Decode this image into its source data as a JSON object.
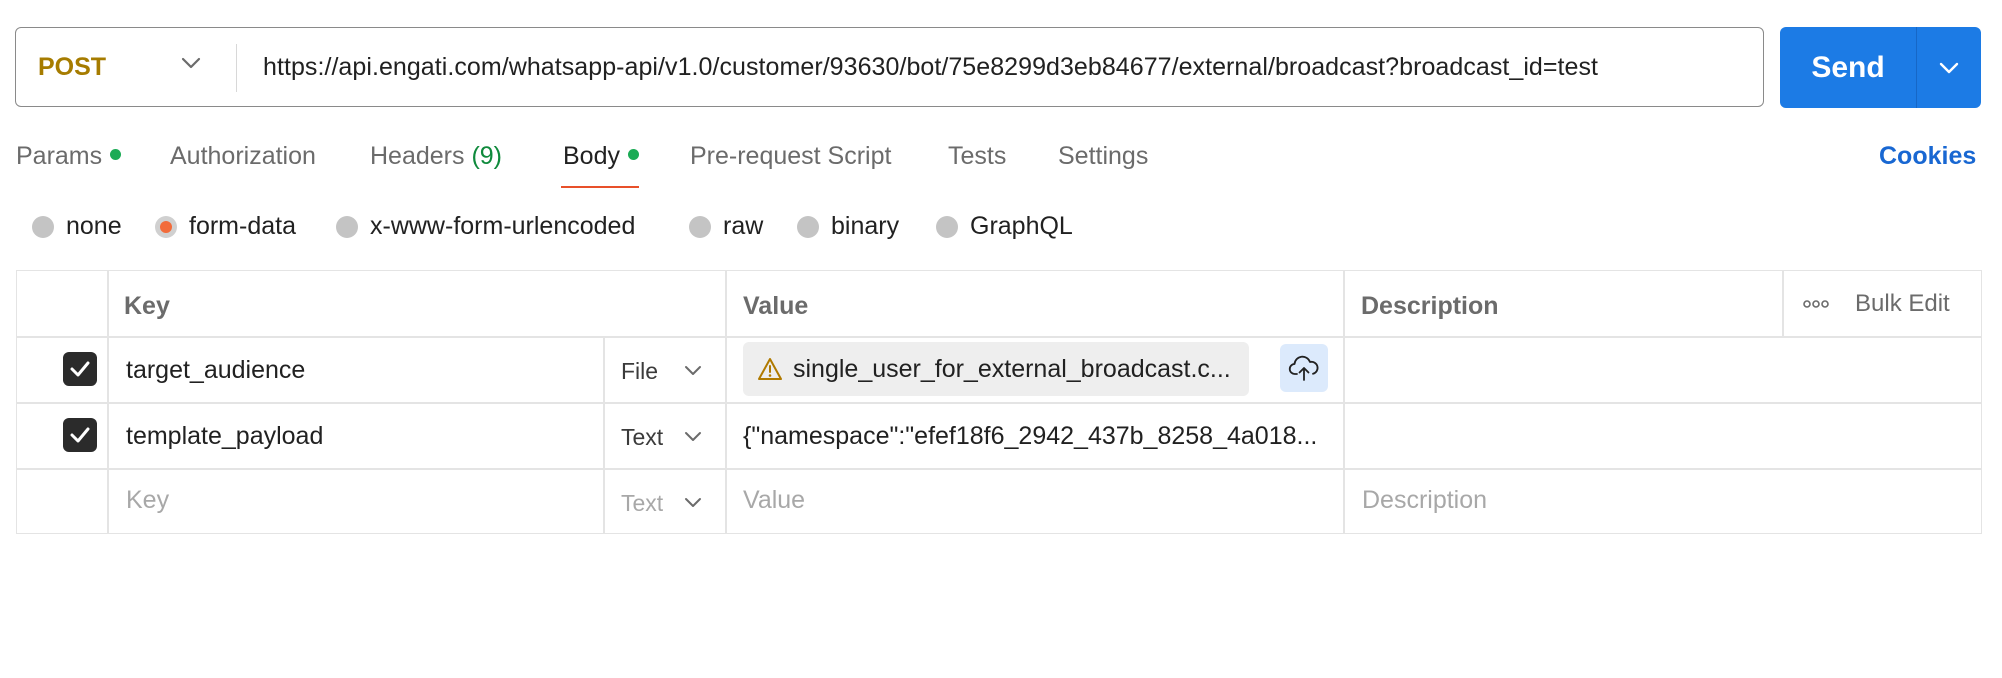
{
  "request": {
    "method": "POST",
    "url": "https://api.engati.com/whatsapp-api/v1.0/customer/93630/bot/75e8299d3eb84677/external/broadcast?broadcast_id=test",
    "send_label": "Send"
  },
  "tabs": {
    "params": "Params",
    "authorization": "Authorization",
    "headers": "Headers",
    "headers_count": "(9)",
    "body": "Body",
    "prerequest": "Pre-request Script",
    "tests": "Tests",
    "settings": "Settings",
    "cookies": "Cookies",
    "active": "Body"
  },
  "body_types": {
    "options": [
      "none",
      "form-data",
      "x-www-form-urlencoded",
      "raw",
      "binary",
      "GraphQL"
    ],
    "selected": "form-data"
  },
  "table": {
    "headers": {
      "key": "Key",
      "value": "Value",
      "description": "Description",
      "bulk_edit": "Bulk Edit"
    },
    "rows": [
      {
        "checked": true,
        "key": "target_audience",
        "type": "File",
        "value": "single_user_for_external_broadcast.c...",
        "description": ""
      },
      {
        "checked": true,
        "key": "template_payload",
        "type": "Text",
        "value": "{\"namespace\":\"efef18f6_2942_437b_8258_4a018...",
        "description": ""
      }
    ],
    "new_row": {
      "key_placeholder": "Key",
      "type": "Text",
      "value_placeholder": "Value",
      "description_placeholder": "Description"
    }
  },
  "colors": {
    "method": "#a67c00",
    "send": "#1c7be5",
    "active_tab_underline": "#e8502a",
    "status_dot": "#1bab55",
    "radio_selected": "#f26b3a",
    "cookies_link": "#1867d2"
  }
}
